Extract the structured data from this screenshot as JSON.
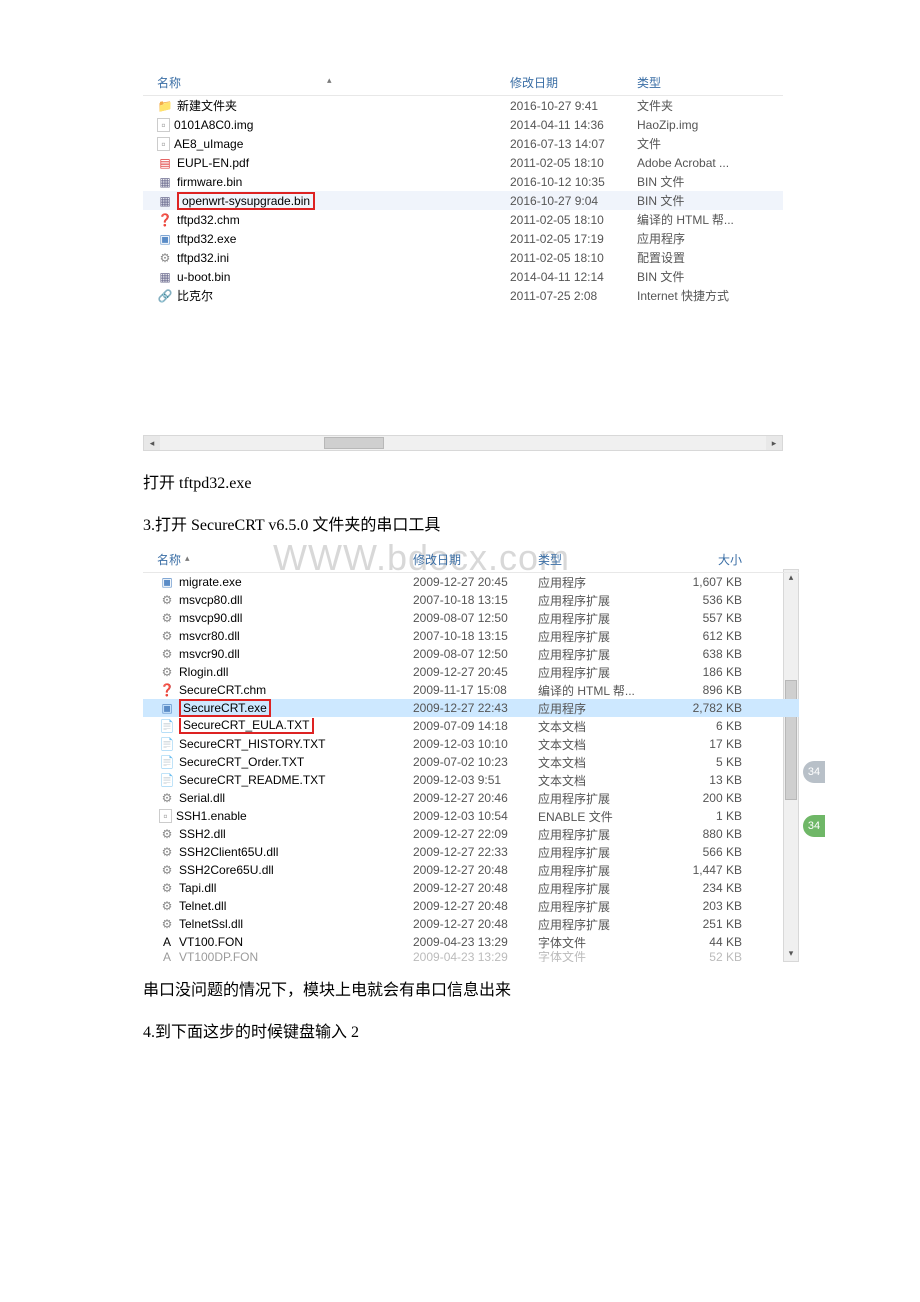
{
  "explorer1": {
    "headers": {
      "name": "名称",
      "date": "修改日期",
      "type": "类型"
    },
    "rows": [
      {
        "icon": "folder",
        "name": "新建文件夹",
        "date": "2016-10-27 9:41",
        "type": "文件夹"
      },
      {
        "icon": "generic",
        "name": "0101A8C0.img",
        "date": "2014-04-11 14:36",
        "type": "HaoZip.img"
      },
      {
        "icon": "generic",
        "name": "AE8_uImage",
        "date": "2016-07-13 14:07",
        "type": "文件"
      },
      {
        "icon": "pdf",
        "name": "EUPL-EN.pdf",
        "date": "2011-02-05 18:10",
        "type": "Adobe Acrobat ..."
      },
      {
        "icon": "bin",
        "name": "firmware.bin",
        "date": "2016-10-12 10:35",
        "type": "BIN 文件"
      },
      {
        "icon": "bin",
        "name": "openwrt-sysupgrade.bin",
        "date": "2016-10-27 9:04",
        "type": "BIN 文件",
        "hl": true
      },
      {
        "icon": "chm",
        "name": "tftpd32.chm",
        "date": "2011-02-05 18:10",
        "type": "编译的 HTML 帮..."
      },
      {
        "icon": "exe",
        "name": "tftpd32.exe",
        "date": "2011-02-05 17:19",
        "type": "应用程序"
      },
      {
        "icon": "ini",
        "name": "tftpd32.ini",
        "date": "2011-02-05 18:10",
        "type": "配置设置"
      },
      {
        "icon": "bin",
        "name": "u-boot.bin",
        "date": "2014-04-11 12:14",
        "type": "BIN 文件"
      },
      {
        "icon": "short",
        "name": "比克尔",
        "date": "2011-07-25 2:08",
        "type": "Internet 快捷方式"
      }
    ]
  },
  "text1": "打开 tftpd32.exe",
  "text2": "3.打开 SecureCRT v6.5.0 文件夹的串口工具",
  "watermark": "WWW.bdocx.com",
  "explorer2": {
    "headers": {
      "name": "名称",
      "date": "修改日期",
      "type": "类型",
      "size": "大小"
    },
    "rows": [
      {
        "icon": "exe",
        "name": "migrate.exe",
        "date": "2009-12-27 20:45",
        "type": "应用程序",
        "size": "1,607 KB"
      },
      {
        "icon": "dll",
        "name": "msvcp80.dll",
        "date": "2007-10-18 13:15",
        "type": "应用程序扩展",
        "size": "536 KB"
      },
      {
        "icon": "dll",
        "name": "msvcp90.dll",
        "date": "2009-08-07 12:50",
        "type": "应用程序扩展",
        "size": "557 KB"
      },
      {
        "icon": "dll",
        "name": "msvcr80.dll",
        "date": "2007-10-18 13:15",
        "type": "应用程序扩展",
        "size": "612 KB"
      },
      {
        "icon": "dll",
        "name": "msvcr90.dll",
        "date": "2009-08-07 12:50",
        "type": "应用程序扩展",
        "size": "638 KB"
      },
      {
        "icon": "dll",
        "name": "Rlogin.dll",
        "date": "2009-12-27 20:45",
        "type": "应用程序扩展",
        "size": "186 KB"
      },
      {
        "icon": "chm",
        "name": "SecureCRT.chm",
        "date": "2009-11-17 15:08",
        "type": "编译的 HTML 帮...",
        "size": "896 KB"
      },
      {
        "icon": "exe",
        "name": "SecureCRT.exe",
        "date": "2009-12-27 22:43",
        "type": "应用程序",
        "size": "2,782 KB",
        "sel": true
      },
      {
        "icon": "txt",
        "name": "SecureCRT_EULA.TXT",
        "date": "2009-07-09 14:18",
        "type": "文本文档",
        "size": "6 KB",
        "out": true
      },
      {
        "icon": "txt",
        "name": "SecureCRT_HISTORY.TXT",
        "date": "2009-12-03 10:10",
        "type": "文本文档",
        "size": "17 KB"
      },
      {
        "icon": "txt",
        "name": "SecureCRT_Order.TXT",
        "date": "2009-07-02 10:23",
        "type": "文本文档",
        "size": "5 KB"
      },
      {
        "icon": "txt",
        "name": "SecureCRT_README.TXT",
        "date": "2009-12-03 9:51",
        "type": "文本文档",
        "size": "13 KB"
      },
      {
        "icon": "dll",
        "name": "Serial.dll",
        "date": "2009-12-27 20:46",
        "type": "应用程序扩展",
        "size": "200 KB"
      },
      {
        "icon": "generic",
        "name": "SSH1.enable",
        "date": "2009-12-03 10:54",
        "type": "ENABLE 文件",
        "size": "1 KB"
      },
      {
        "icon": "dll",
        "name": "SSH2.dll",
        "date": "2009-12-27 22:09",
        "type": "应用程序扩展",
        "size": "880 KB"
      },
      {
        "icon": "dll",
        "name": "SSH2Client65U.dll",
        "date": "2009-12-27 22:33",
        "type": "应用程序扩展",
        "size": "566 KB"
      },
      {
        "icon": "dll",
        "name": "SSH2Core65U.dll",
        "date": "2009-12-27 20:48",
        "type": "应用程序扩展",
        "size": "1,447 KB"
      },
      {
        "icon": "dll",
        "name": "Tapi.dll",
        "date": "2009-12-27 20:48",
        "type": "应用程序扩展",
        "size": "234 KB"
      },
      {
        "icon": "dll",
        "name": "Telnet.dll",
        "date": "2009-12-27 20:48",
        "type": "应用程序扩展",
        "size": "203 KB"
      },
      {
        "icon": "dll",
        "name": "TelnetSsl.dll",
        "date": "2009-12-27 20:48",
        "type": "应用程序扩展",
        "size": "251 KB"
      },
      {
        "icon": "fon",
        "name": "VT100.FON",
        "date": "2009-04-23 13:29",
        "type": "字体文件",
        "size": "44 KB"
      },
      {
        "icon": "fon",
        "name": "VT100DP.FON",
        "date": "2009-04-23 13:29",
        "type": "字体文件",
        "size": "52 KB",
        "cut": true
      }
    ]
  },
  "bubble1": "34",
  "bubble2": "34",
  "text3": "串口没问题的情况下，模块上电就会有串口信息出来",
  "text4": "4.到下面这步的时候键盘输入 2"
}
